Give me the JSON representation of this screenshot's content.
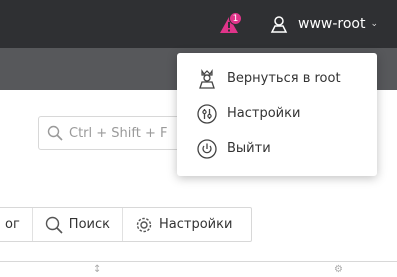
{
  "header": {
    "notifications_count": "1",
    "user_name": "www-root"
  },
  "search": {
    "placeholder": "Ctrl + Shift + F"
  },
  "toolbar": {
    "first_label": "ог",
    "search_label": "Поиск",
    "settings_label": "Настройки"
  },
  "user_menu": {
    "items": [
      {
        "label": "Вернуться в root",
        "icon": "admin-icon"
      },
      {
        "label": "Настройки",
        "icon": "settings-icon"
      },
      {
        "label": "Выйти",
        "icon": "power-icon"
      }
    ]
  },
  "colors": {
    "topbar": "#2f3033",
    "subbar": "#57585b",
    "badge": "#e0348a",
    "accent": "#4aa3df"
  }
}
